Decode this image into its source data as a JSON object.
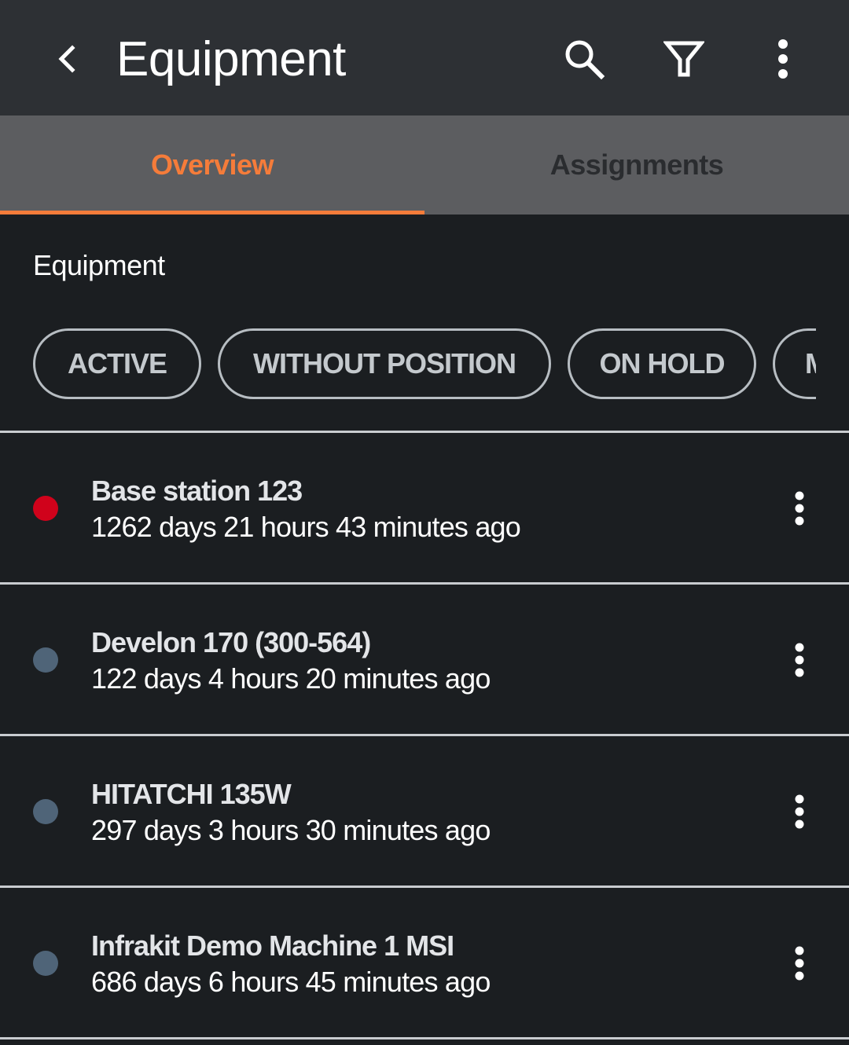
{
  "appbar": {
    "title": "Equipment",
    "back_icon": "chevron-left-icon",
    "search_icon": "search-icon",
    "filter_icon": "filter-icon",
    "more_icon": "more-vertical-icon"
  },
  "tabs": [
    {
      "label": "Overview",
      "selected": true
    },
    {
      "label": "Assignments",
      "selected": false
    }
  ],
  "section": {
    "title": "Equipment"
  },
  "chips": [
    {
      "label": "ACTIVE"
    },
    {
      "label": "WITHOUT POSITION"
    },
    {
      "label": "ON HOLD"
    },
    {
      "label": "M"
    }
  ],
  "equipment": [
    {
      "name": "Base station 123",
      "last_seen": "1262 days 21 hours 43 minutes ago",
      "status_color": "#d0021b"
    },
    {
      "name": "Develon 170 (300-564)",
      "last_seen": "122 days 4 hours 20 minutes ago",
      "status_color": "#4f6478"
    },
    {
      "name": "HITATCHI 135W",
      "last_seen": "297 days 3 hours 30 minutes ago",
      "status_color": "#4f6478"
    },
    {
      "name": "Infrakit Demo Machine 1 MSI",
      "last_seen": "686 days 6 hours 45 minutes ago",
      "status_color": "#4f6478"
    }
  ],
  "colors": {
    "accent": "#f57c3a",
    "appbar": "#2d3034",
    "tabbar": "#5c5d60",
    "background": "#1b1e21"
  }
}
